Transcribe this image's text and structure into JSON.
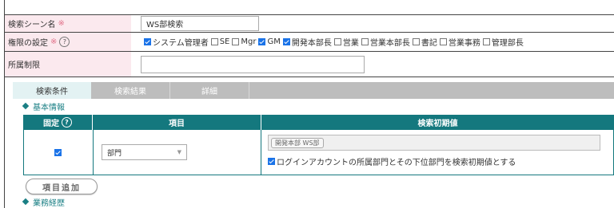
{
  "form": {
    "scene_name_label": "検索シーン名",
    "required_mark": "※",
    "scene_name_value": "WS部検索",
    "permission_label": "権限の設定",
    "help_mark": "?",
    "affiliation_label": "所属制限",
    "affiliation_value": ""
  },
  "permissions": [
    {
      "label": "システム管理者",
      "checked": true
    },
    {
      "label": "SE",
      "checked": false
    },
    {
      "label": "Mgr",
      "checked": false
    },
    {
      "label": "GM",
      "checked": true
    },
    {
      "label": "開発本部長",
      "checked": true
    },
    {
      "label": "営業",
      "checked": false
    },
    {
      "label": "営業本部長",
      "checked": false
    },
    {
      "label": "書記",
      "checked": false
    },
    {
      "label": "営業事務",
      "checked": false
    },
    {
      "label": "管理部長",
      "checked": false
    }
  ],
  "tabs": {
    "conditions": "検索条件",
    "results": "検索結果",
    "details": "詳細"
  },
  "sections": {
    "basic": "基本情報",
    "career": "業務経歴"
  },
  "table": {
    "header_fixed": "固定",
    "header_item": "項目",
    "header_initial": "検索初期値",
    "row": {
      "fixed_checked": true,
      "item_select": "部門",
      "initial_tag": "開発本部 WS部",
      "include_sub_label": "ログインアカウントの所属部門とその下位部門を検索初期値とする",
      "include_sub_checked": true
    }
  },
  "add_item_button": "項目追加",
  "colors": {
    "label_bg": "#fbe9ee",
    "required": "#e1728a",
    "header_teal": "#14787e",
    "section_teal": "#1a7f84",
    "checkbox_blue": "#1a73e8",
    "tab_active": "#e3f2f3",
    "tab_inactive": "#bdbdbd"
  },
  "icons": {
    "chevron": "chevron-down-icon",
    "diamond": "diamond-icon",
    "help": "help-circle-icon"
  }
}
